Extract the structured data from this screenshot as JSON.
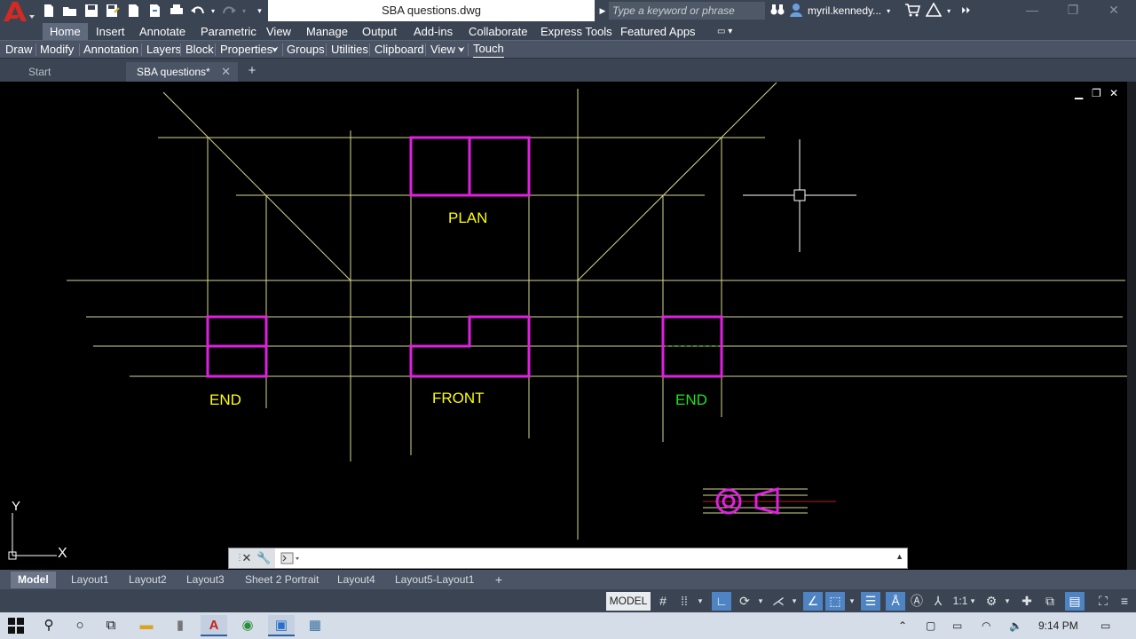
{
  "app": {
    "doc_title": "SBA questions.dwg",
    "search_placeholder": "Type a keyword or phrase",
    "user": "myril.kennedy...",
    "win_minimize": "—",
    "win_restore": "❐",
    "win_close": "✕"
  },
  "ribbon": {
    "tabs": [
      {
        "label": "Home"
      },
      {
        "label": "Insert"
      },
      {
        "label": "Annotate"
      },
      {
        "label": "Parametric"
      },
      {
        "label": "View"
      },
      {
        "label": "Manage"
      },
      {
        "label": "Output"
      },
      {
        "label": "Add-ins"
      },
      {
        "label": "Collaborate"
      },
      {
        "label": "Express Tools"
      },
      {
        "label": "Featured Apps"
      }
    ],
    "panels": [
      {
        "label": "Draw"
      },
      {
        "label": "Modify"
      },
      {
        "label": "Annotation"
      },
      {
        "label": "Layers"
      },
      {
        "label": "Block"
      },
      {
        "label": "Properties"
      },
      {
        "label": "Groups"
      },
      {
        "label": "Utilities"
      },
      {
        "label": "Clipboard"
      },
      {
        "label": "View"
      },
      {
        "label": "Touch"
      }
    ]
  },
  "filetabs": {
    "start": "Start",
    "active": "SBA questions*",
    "close": "✕",
    "add": "+"
  },
  "drawing": {
    "labels": {
      "plan": "PLAN",
      "end_left": "END",
      "front": "FRONT",
      "end_right": "END"
    },
    "ucs": {
      "y": "Y",
      "x": "X"
    }
  },
  "layout_tabs": [
    {
      "label": "Model"
    },
    {
      "label": "Layout1"
    },
    {
      "label": "Layout2"
    },
    {
      "label": "Layout3"
    },
    {
      "label": "Sheet 2 Portrait"
    },
    {
      "label": "Layout4"
    },
    {
      "label": "Layout5-Layout1"
    }
  ],
  "layout_add": "+",
  "status": {
    "model": "MODEL",
    "scale": "1:1"
  },
  "taskbar": {
    "time": "9:14 PM"
  },
  "colors": {
    "magenta": "#e020e0",
    "yellow_line": "#d8d890",
    "label_yellow": "#ffff00",
    "label_green": "#20e020"
  }
}
